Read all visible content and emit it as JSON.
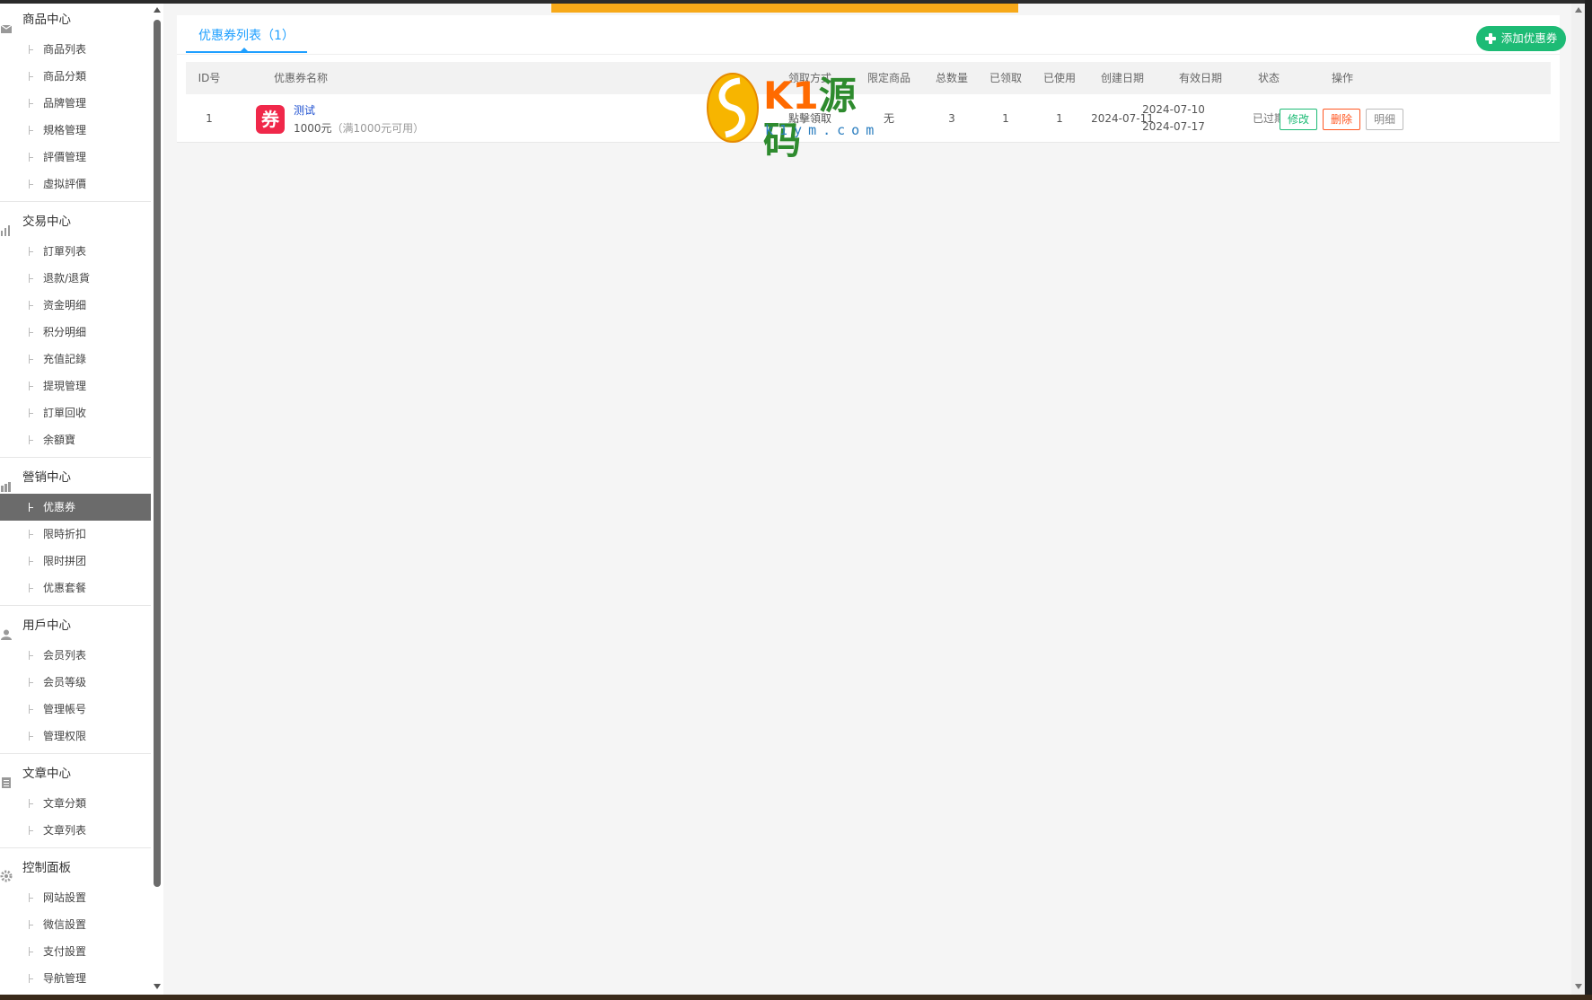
{
  "sidebar": {
    "groups": [
      {
        "title": "商品中心",
        "icon": "box-icon",
        "items": [
          "商品列表",
          "商品分類",
          "品牌管理",
          "規格管理",
          "評價管理",
          "虛拟評價"
        ]
      },
      {
        "title": "交易中心",
        "icon": "chart-icon",
        "items": [
          "訂單列表",
          "退款/退貨",
          "资金明细",
          "积分明细",
          "充值記錄",
          "提現管理",
          "訂單回收",
          "余額寶"
        ]
      },
      {
        "title": "營销中心",
        "icon": "marketing-icon",
        "items": [
          "优惠券",
          "限時折扣",
          "限时拼团",
          "优惠套餐"
        ],
        "active": "优惠券"
      },
      {
        "title": "用戶中心",
        "icon": "user-icon",
        "items": [
          "会员列表",
          "会员等级",
          "管理帳号",
          "管理权限"
        ]
      },
      {
        "title": "文章中心",
        "icon": "document-icon",
        "items": [
          "文章分類",
          "文章列表"
        ]
      },
      {
        "title": "控制面板",
        "icon": "gear-icon",
        "items": [
          "网站設置",
          "微信設置",
          "支付設置",
          "导航管理"
        ]
      }
    ]
  },
  "tab": {
    "label": "优惠券列表（1）"
  },
  "add_button": {
    "label": "添加优惠券"
  },
  "table": {
    "headers": [
      "ID号",
      "优惠券名称",
      "领取方式",
      "限定商品",
      "总数量",
      "已领取",
      "已使用",
      "创建日期",
      "有效日期",
      "状态",
      "操作"
    ],
    "rows": [
      {
        "id": "1",
        "badge": "券",
        "name": "测试",
        "amount": "1000元",
        "condition": "（满1000元可用）",
        "claim_method": "點擊領取",
        "limited_goods": "无",
        "total": "3",
        "claimed": "1",
        "used": "1",
        "created": "2024-07-11",
        "valid_from": "2024-07-10",
        "valid_to": "2024-07-17",
        "status": "已过期",
        "actions": {
          "edit": "修改",
          "delete": "删除",
          "detail": "明细"
        }
      }
    ]
  },
  "watermark": {
    "brand_k1": "K1",
    "brand_cn": "源码",
    "url": "k1ym.com"
  },
  "colors": {
    "accent": "#1e9fff",
    "add_button": "#1dbb75",
    "delete": "#ff5722",
    "badge": "#f0284a",
    "top_bar": "#f7a919",
    "active_menu": "#6b6b6b"
  }
}
